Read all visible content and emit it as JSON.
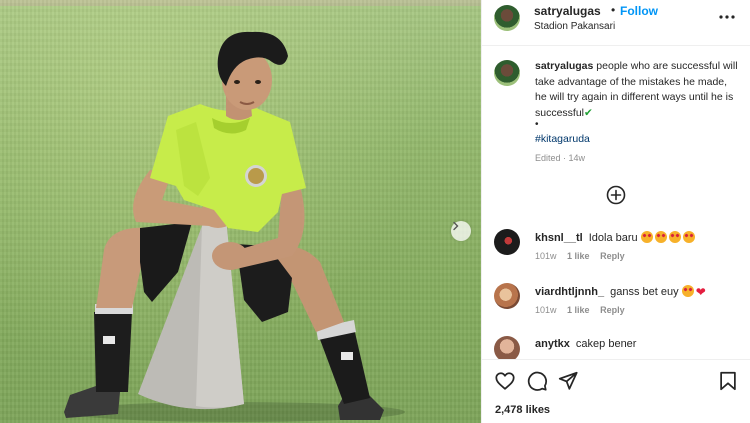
{
  "post": {
    "username": "satryalugas",
    "separator": "•",
    "follow_label": "Follow",
    "location": "Stadion Pakansari",
    "more_icon": "more-horizontal-icon",
    "next_icon": "chevron-right-icon"
  },
  "caption": {
    "username": "satryalugas",
    "text": "people who are successful will take advantage of the mistakes he made, he will try again in different ways until he is successful",
    "emoji": "✔",
    "bullet": "•",
    "hashtag": "#kitagaruda",
    "edited": "Edited · 14w"
  },
  "load_more_icon": "plus-circle-icon",
  "comments": [
    {
      "username": "khsnl__tl",
      "text": "Idola baru",
      "emojis": [
        "heart-eyes",
        "heart-eyes",
        "heart-eyes",
        "heart-eyes"
      ],
      "age": "101w",
      "likes": "1 like",
      "reply": "Reply",
      "avatar_color": "#1c1c1c"
    },
    {
      "username": "viardhtljnnh_",
      "text": "ganss bet euy",
      "emojis": [
        "heart-eyes",
        "red-heart"
      ],
      "age": "101w",
      "likes": "1 like",
      "reply": "Reply",
      "avatar_color": "#c98f6a"
    },
    {
      "username": "anytkx",
      "text": "cakep bener",
      "avatar_color": "#b98a72"
    }
  ],
  "actions": {
    "like_icon": "heart-outline-icon",
    "comment_icon": "comment-icon",
    "share_icon": "paper-plane-icon",
    "save_icon": "bookmark-icon",
    "likes_count": "2,478 likes"
  },
  "colors": {
    "follow_blue": "#0095f6",
    "hashtag_blue": "#00376b",
    "muted_gray": "#8e8e8e",
    "jersey_lime": "#c7ec4a"
  }
}
